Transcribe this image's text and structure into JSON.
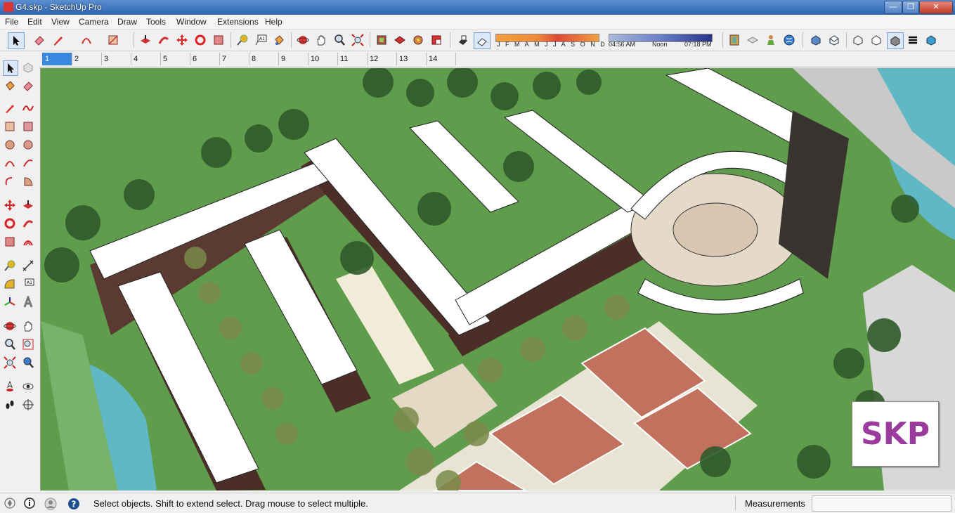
{
  "window": {
    "title": "G4.skp - SketchUp Pro",
    "minimize": "—",
    "maximize": "❐",
    "close": "✕"
  },
  "menu": [
    "File",
    "Edit",
    "View",
    "Camera",
    "Draw",
    "Tools",
    "Window",
    "Extensions",
    "Help"
  ],
  "shadows": {
    "months": [
      "J",
      "F",
      "M",
      "A",
      "M",
      "J",
      "J",
      "A",
      "S",
      "O",
      "N",
      "D"
    ],
    "time_start": "04:56 AM",
    "time_mid": "Noon",
    "time_end": "07:18 PM"
  },
  "scene_tabs": [
    "1",
    "2",
    "3",
    "4",
    "5",
    "6",
    "7",
    "8",
    "9",
    "10",
    "11",
    "12",
    "13",
    "14"
  ],
  "active_scene": "1",
  "status": {
    "hint": "Select objects. Shift to extend select. Drag mouse to select multiple.",
    "measurements_label": "Measurements",
    "measurements_value": ""
  },
  "badge": {
    "text": "SKP"
  },
  "colors": {
    "title_bar": "#2f66b4",
    "grass": "#5f9c4c",
    "roof": "#ffffff",
    "court": "#c2715e",
    "water": "#5fb8c4",
    "active_tab": "#3a88e0",
    "badge_text": "#9b3b9e"
  }
}
